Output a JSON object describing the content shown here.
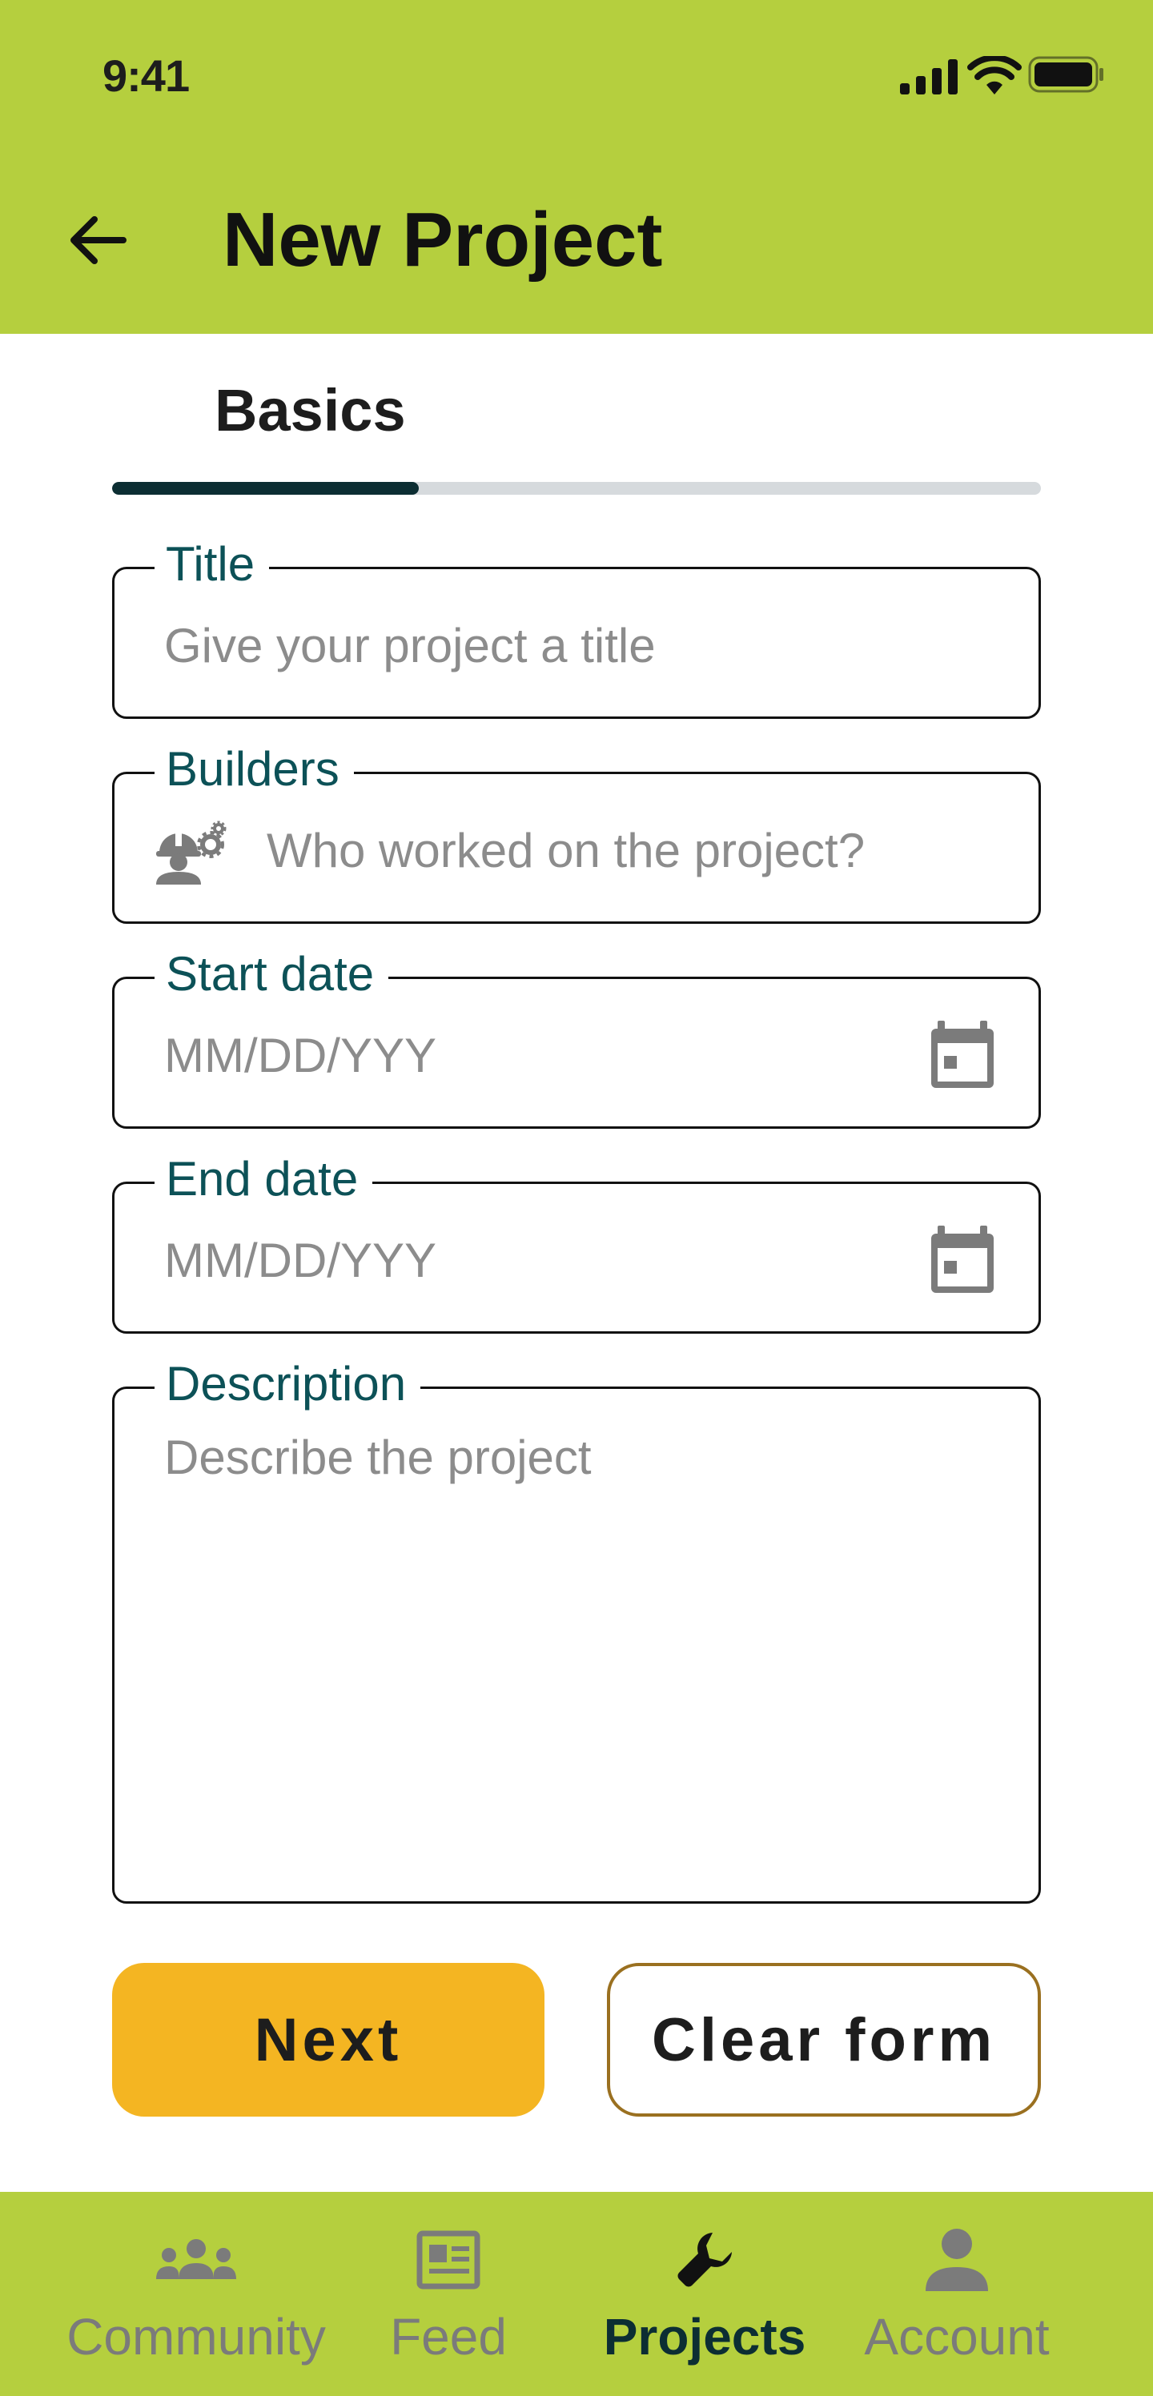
{
  "status_bar": {
    "time": "9:41"
  },
  "header": {
    "title": "New Project",
    "back_icon": "arrow-left-icon"
  },
  "stepper": {
    "label": "Basics",
    "progress": 0.33
  },
  "form": {
    "title": {
      "label": "Title",
      "placeholder": "Give your project a title"
    },
    "builders": {
      "label": "Builders",
      "placeholder": "Who worked on the project?",
      "icon": "builder-icon"
    },
    "start_date": {
      "label": "Start date",
      "placeholder": "MM/DD/YYY",
      "icon": "calendar-icon"
    },
    "end_date": {
      "label": "End date",
      "placeholder": "MM/DD/YYY",
      "icon": "calendar-icon"
    },
    "description": {
      "label": "Description",
      "placeholder": "Describe the project"
    }
  },
  "actions": {
    "next_label": "Next",
    "clear_label": "Clear form"
  },
  "bottom_nav": {
    "items": [
      {
        "label": "Community",
        "icon": "people-icon",
        "active": false
      },
      {
        "label": "Feed",
        "icon": "newspaper-icon",
        "active": false
      },
      {
        "label": "Projects",
        "icon": "wrench-icon",
        "active": true
      },
      {
        "label": "Account",
        "icon": "person-icon",
        "active": false
      }
    ]
  },
  "colors": {
    "brand_green": "#b5cf3e",
    "accent_yellow": "#f4b522",
    "label_teal": "#0c5157",
    "progress_dark": "#0c2e33",
    "clear_border": "#9a7020"
  }
}
